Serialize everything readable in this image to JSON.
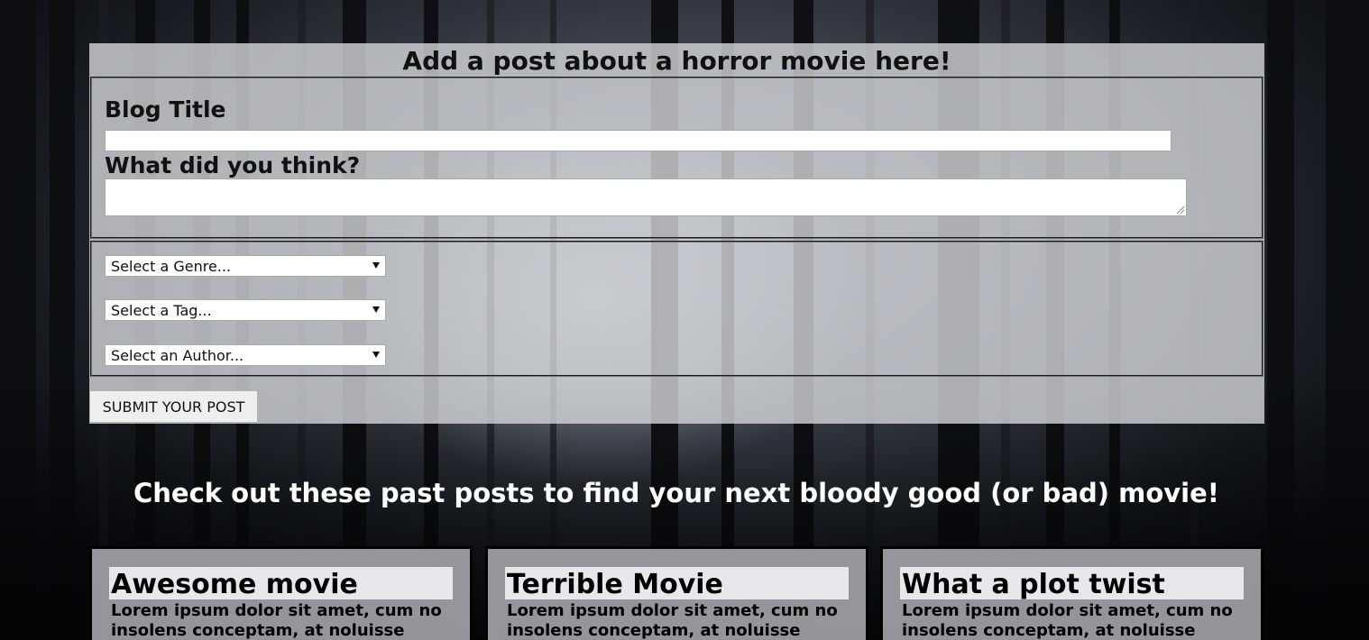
{
  "form": {
    "heading": "Add a post about a horror movie here!",
    "title_label": "Blog Title",
    "title_value": "",
    "think_label": "What did you think?",
    "think_value": "",
    "genre_select": "Select a Genre...",
    "tag_select": "Select a Tag...",
    "author_select": "Select an Author...",
    "submit_label": "SUBMIT YOUR POST"
  },
  "past": {
    "heading": "Check out these past posts to find your next bloody good (or bad) movie!",
    "posts": [
      {
        "title": "Awesome movie",
        "body": "Lorem ipsum dolor sit amet, cum no insolens conceptam, at noluisse"
      },
      {
        "title": "Terrible Movie",
        "body": "Lorem ipsum dolor sit amet, cum no insolens conceptam, at noluisse"
      },
      {
        "title": "What a plot twist",
        "body": "Lorem ipsum dolor sit amet, cum no insolens conceptam, at noluisse"
      }
    ]
  },
  "colors": {
    "panel": "#d2d2d6",
    "card": "#aaaaae",
    "heading_light": "#ffffff"
  }
}
